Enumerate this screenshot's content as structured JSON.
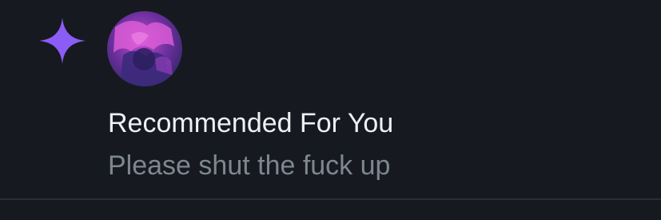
{
  "notification": {
    "type_icon": "sparkle-icon",
    "avatar_icon": "avatar-image",
    "title": "Recommended For You",
    "text": "Please shut the fuck up"
  },
  "colors": {
    "background": "#16191f",
    "sparkle": "#8b5cf6",
    "title_text": "#eef0f2",
    "body_text": "#7d8791",
    "divider": "#2a2f36"
  }
}
